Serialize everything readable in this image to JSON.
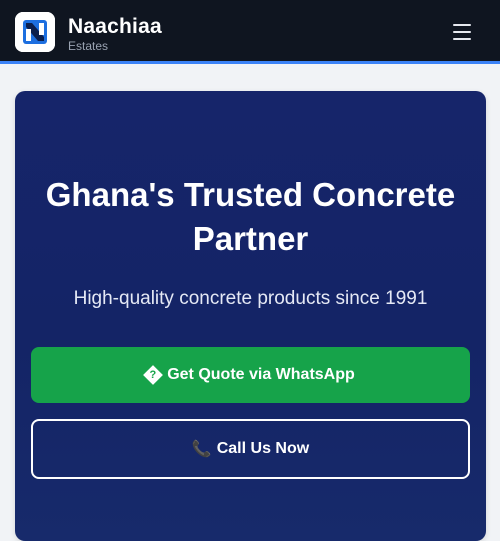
{
  "header": {
    "brand_name": "Naachiaa",
    "brand_sub": "Estates",
    "logo_icon": "brand-n-logo-icon",
    "menu_icon": "hamburger-menu-icon"
  },
  "hero": {
    "title": "Ghana's Trusted Concrete Partner",
    "subtitle": "High-quality concrete products since 1991",
    "whatsapp_button": {
      "label": "Get Quote via WhatsApp",
      "icon": "?",
      "icon_name": "missing-glyph-icon"
    },
    "call_button": {
      "label": "Call Us Now",
      "icon": "📞",
      "icon_name": "phone-icon"
    }
  },
  "colors": {
    "header_bg": "#0f1520",
    "header_accent": "#3b82f6",
    "hero_bg": "#152568",
    "whatsapp_green": "#16a34a",
    "page_bg": "#f1f3f6"
  }
}
